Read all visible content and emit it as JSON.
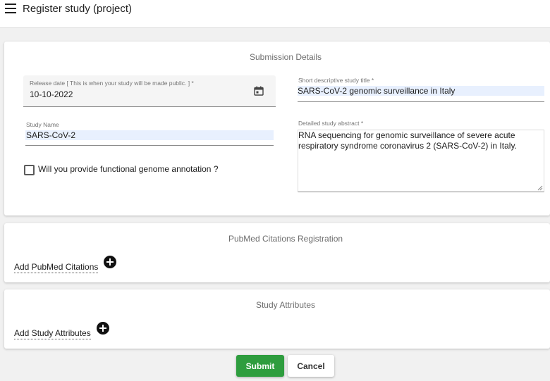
{
  "header": {
    "title": "Register study (project)"
  },
  "submission": {
    "section_title": "Submission Details",
    "release_date": {
      "label": "Release date [ This is when your study will be made public. ] *",
      "value": "10-10-2022"
    },
    "study_name": {
      "label": "Study Name",
      "value": "SARS-CoV-2"
    },
    "study_title": {
      "label": "Short descriptive study title *",
      "value": "SARS-CoV-2 genomic surveillance in Italy"
    },
    "study_abstract": {
      "label": "Detailed study abstract *",
      "value": "RNA sequencing for genomic surveillance of severe acute respiratory syndrome coronavirus 2 (SARS-CoV-2) in Italy."
    },
    "functional_annotation": {
      "label": "Will you provide functional genome annotation ?",
      "checked": false
    }
  },
  "pubmed": {
    "section_title": "PubMed Citations Registration",
    "add_label": "Add PubMed Citations"
  },
  "attributes": {
    "section_title": "Study Attributes",
    "add_label": "Add Study Attributes"
  },
  "actions": {
    "submit_label": "Submit",
    "cancel_label": "Cancel"
  },
  "colors": {
    "submit_button": "#2e9d3e",
    "autofill_highlight": "#e8f0fe"
  }
}
